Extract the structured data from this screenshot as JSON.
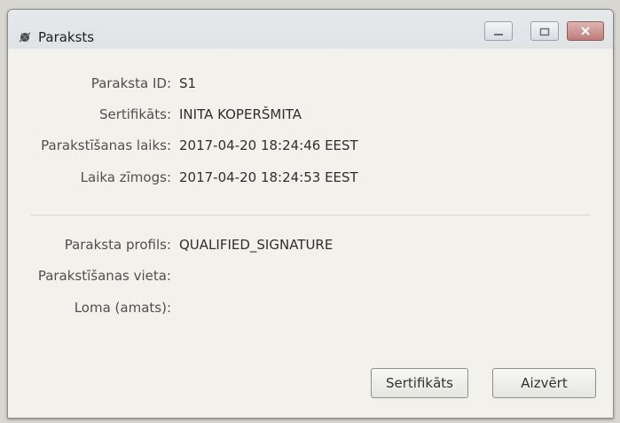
{
  "window": {
    "title": "Paraksts"
  },
  "details": [
    {
      "label": "Paraksta ID:",
      "value": "S1"
    },
    {
      "label": "Sertifikāts:",
      "value": "INITA KOPERŠMITA"
    },
    {
      "label": "Parakstīšanas laiks:",
      "value": "2017-04-20 18:24:46 EEST"
    },
    {
      "label": "Laika zīmogs:",
      "value": "2017-04-20 18:24:53 EEST"
    }
  ],
  "extra": [
    {
      "label": "Paraksta profils:",
      "value": "QUALIFIED_SIGNATURE"
    },
    {
      "label": "Parakstīšanas vieta:",
      "value": ""
    },
    {
      "label": "Loma (amats):",
      "value": ""
    }
  ],
  "buttons": {
    "certificate": "Sertifikāts",
    "close": "Aizvērt"
  },
  "icons": {
    "app": "signature-icon",
    "minimize": "minimize-icon",
    "maximize": "maximize-icon",
    "close": "close-icon"
  }
}
